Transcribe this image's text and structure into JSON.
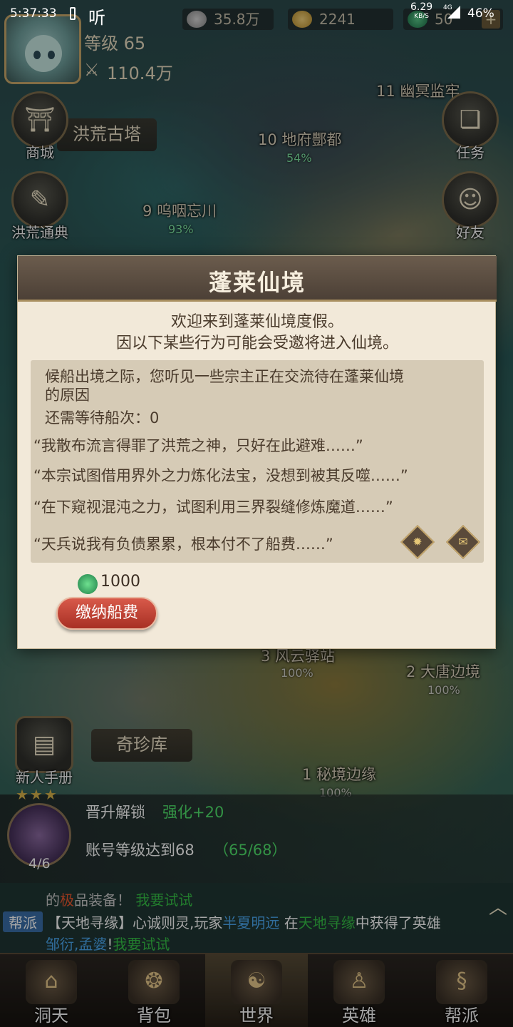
{
  "status_bar": {
    "time": "5:37:33",
    "carrier": "听",
    "net_speed": "6.29",
    "net_speed_unit": "KB/S",
    "network": "4G",
    "battery": "46%"
  },
  "hud": {
    "level": "等级 65",
    "power": "110.4万",
    "silver": "35.8万",
    "gold": "2241",
    "jade": "50",
    "plus": "+"
  },
  "side_buttons": {
    "shop": "商城",
    "guide": "洪荒通典",
    "task": "任务",
    "friend": "好友",
    "newbie": "新人手册"
  },
  "map": {
    "tower": "洪荒古塔",
    "stage11": "11 幽冥监牢",
    "stage10": "10 地府酆都",
    "stage10_pct": "54%",
    "stage9": "9 呜咽忘川",
    "stage9_pct": "93%",
    "stage3": "3 风云驿站",
    "stage3_pct": "100%",
    "stage2": "2 大唐边境",
    "stage2_pct": "100%",
    "stage1": "1 秘境边缘",
    "stage1_pct": "100%",
    "treasury": "奇珍库"
  },
  "dialog": {
    "title": "蓬莱仙境",
    "intro_line1": "欢迎来到蓬莱仙境度假。",
    "intro_line2": "因以下某些行为可能会受邀将进入仙境。",
    "desc_line1": "候船出境之际，您听见一些宗主正在交流待在蓬莱仙境",
    "desc_line2": "的原因",
    "wait_count": "还需等待船次：0",
    "reasons": [
      "“我散布流言得罪了洪荒之神，只好在此避难……”",
      "“本宗试图借用界外之力炼化法宝，没想到被其反噬……”",
      "“在下窥视混沌之力，试图利用三界裂缝修炼魔道……”",
      "“天兵说我有负债累累，根本付不了船费……”"
    ],
    "fee_amount": "1000",
    "pay_button": "缴纳船费"
  },
  "unlock": {
    "title": "晋升解锁",
    "reward": "强化+20",
    "requirement": "账号等级达到68",
    "progress": "（65/68）",
    "count": "4/6",
    "stars": "★★★"
  },
  "chat": {
    "line1_a": "的",
    "line1_b": "极",
    "line1_c": "品装备！",
    "line1_d": "我要试试",
    "tag": "帮派",
    "line2_a": "【天地寻缘】心诚则灵,玩家",
    "line2_b": "半夏明远",
    "line2_c": "在",
    "line2_d": "天地寻缘",
    "line2_e": "中获得了英雄",
    "line3_a": "邹衍,孟婆",
    "line3_b": "!",
    "line3_c": "我要试试",
    "toggle": "︿"
  },
  "nav": [
    {
      "label": "洞天",
      "icon": "⌂"
    },
    {
      "label": "背包",
      "icon": "❂"
    },
    {
      "label": "世界",
      "icon": "☯"
    },
    {
      "label": "英雄",
      "icon": "♙"
    },
    {
      "label": "帮派",
      "icon": "§"
    }
  ],
  "colors": {
    "accent_red": "#c43a2c",
    "green_text": "#4fe06a",
    "dialog_bg": "#f2e9d9"
  }
}
